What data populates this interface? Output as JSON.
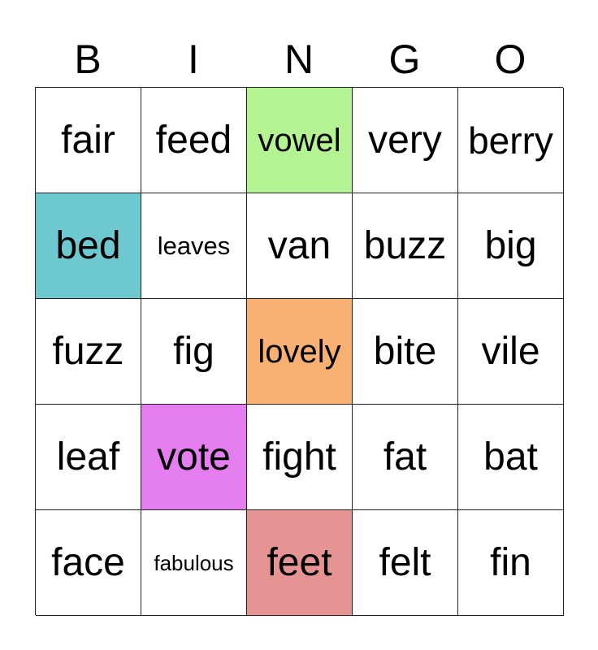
{
  "header": [
    "B",
    "I",
    "N",
    "G",
    "O"
  ],
  "cells": [
    {
      "word": "fair",
      "bg": "#ffffff",
      "size": "sz-xl"
    },
    {
      "word": "feed",
      "bg": "#ffffff",
      "size": "sz-xl"
    },
    {
      "word": "vowel",
      "bg": "#b3f391",
      "size": "sz-m"
    },
    {
      "word": "very",
      "bg": "#ffffff",
      "size": "sz-xl"
    },
    {
      "word": "berry",
      "bg": "#ffffff",
      "size": "sz-l"
    },
    {
      "word": "bed",
      "bg": "#6dc8cf",
      "size": "sz-xl"
    },
    {
      "word": "leaves",
      "bg": "#ffffff",
      "size": "sz-s"
    },
    {
      "word": "van",
      "bg": "#ffffff",
      "size": "sz-xl"
    },
    {
      "word": "buzz",
      "bg": "#ffffff",
      "size": "sz-xl"
    },
    {
      "word": "big",
      "bg": "#ffffff",
      "size": "sz-xl"
    },
    {
      "word": "fuzz",
      "bg": "#ffffff",
      "size": "sz-xl"
    },
    {
      "word": "fig",
      "bg": "#ffffff",
      "size": "sz-xl"
    },
    {
      "word": "lovely",
      "bg": "#f9b173",
      "size": "sz-m"
    },
    {
      "word": "bite",
      "bg": "#ffffff",
      "size": "sz-xl"
    },
    {
      "word": "vile",
      "bg": "#ffffff",
      "size": "sz-xl"
    },
    {
      "word": "leaf",
      "bg": "#ffffff",
      "size": "sz-xl"
    },
    {
      "word": "vote",
      "bg": "#e57ef1",
      "size": "sz-xl"
    },
    {
      "word": "fight",
      "bg": "#ffffff",
      "size": "sz-xl"
    },
    {
      "word": "fat",
      "bg": "#ffffff",
      "size": "sz-xl"
    },
    {
      "word": "bat",
      "bg": "#ffffff",
      "size": "sz-xl"
    },
    {
      "word": "face",
      "bg": "#ffffff",
      "size": "sz-xl"
    },
    {
      "word": "fabulous",
      "bg": "#ffffff",
      "size": "sz-xs"
    },
    {
      "word": "feet",
      "bg": "#e69394",
      "size": "sz-xl"
    },
    {
      "word": "felt",
      "bg": "#ffffff",
      "size": "sz-xl"
    },
    {
      "word": "fin",
      "bg": "#ffffff",
      "size": "sz-xl"
    }
  ]
}
